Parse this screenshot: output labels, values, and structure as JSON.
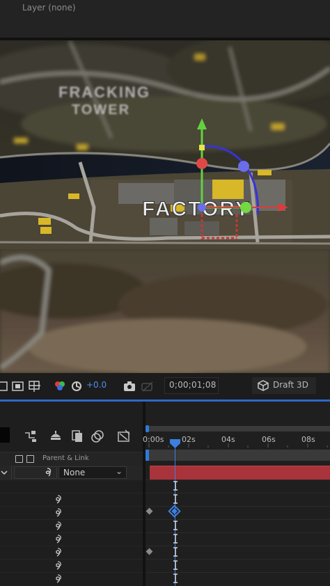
{
  "header": {
    "layer_label": "Layer  (none)"
  },
  "viewer": {
    "map_labels": {
      "top_line1": "FRACKING",
      "top_line2": "TOWER",
      "main": "FACTORY"
    },
    "colors": {
      "x_axis": "#e03a3a",
      "y_axis": "#63d13f",
      "z_axis": "#3c49e8",
      "path": "#3633d8"
    }
  },
  "toolbar": {
    "icons": [
      "region-of-interest-icon",
      "transparency-grid-icon",
      "guides-icon",
      "channel-icon",
      "exposure-reset-icon",
      "snapshot-icon",
      "show-snapshot-icon"
    ],
    "exposure": "+0.0",
    "timecode": "0;00;01;08",
    "draft_label": "Draft 3D"
  },
  "timeline": {
    "panel_icons": [
      "shy-layers-icon",
      "frame-blending-icon",
      "motion-blur-icon",
      "graph-editor-icon",
      "composition-flowchart-icon"
    ],
    "header": {
      "parent_link_label": "Parent & Link"
    },
    "layer": {
      "parent_value": "None"
    },
    "ruler": {
      "labels": [
        "0:00s",
        "02s",
        "04s",
        "06s",
        "08s"
      ]
    },
    "accent": "#2f7ad8",
    "layer_bar_color": "#a9333a"
  }
}
